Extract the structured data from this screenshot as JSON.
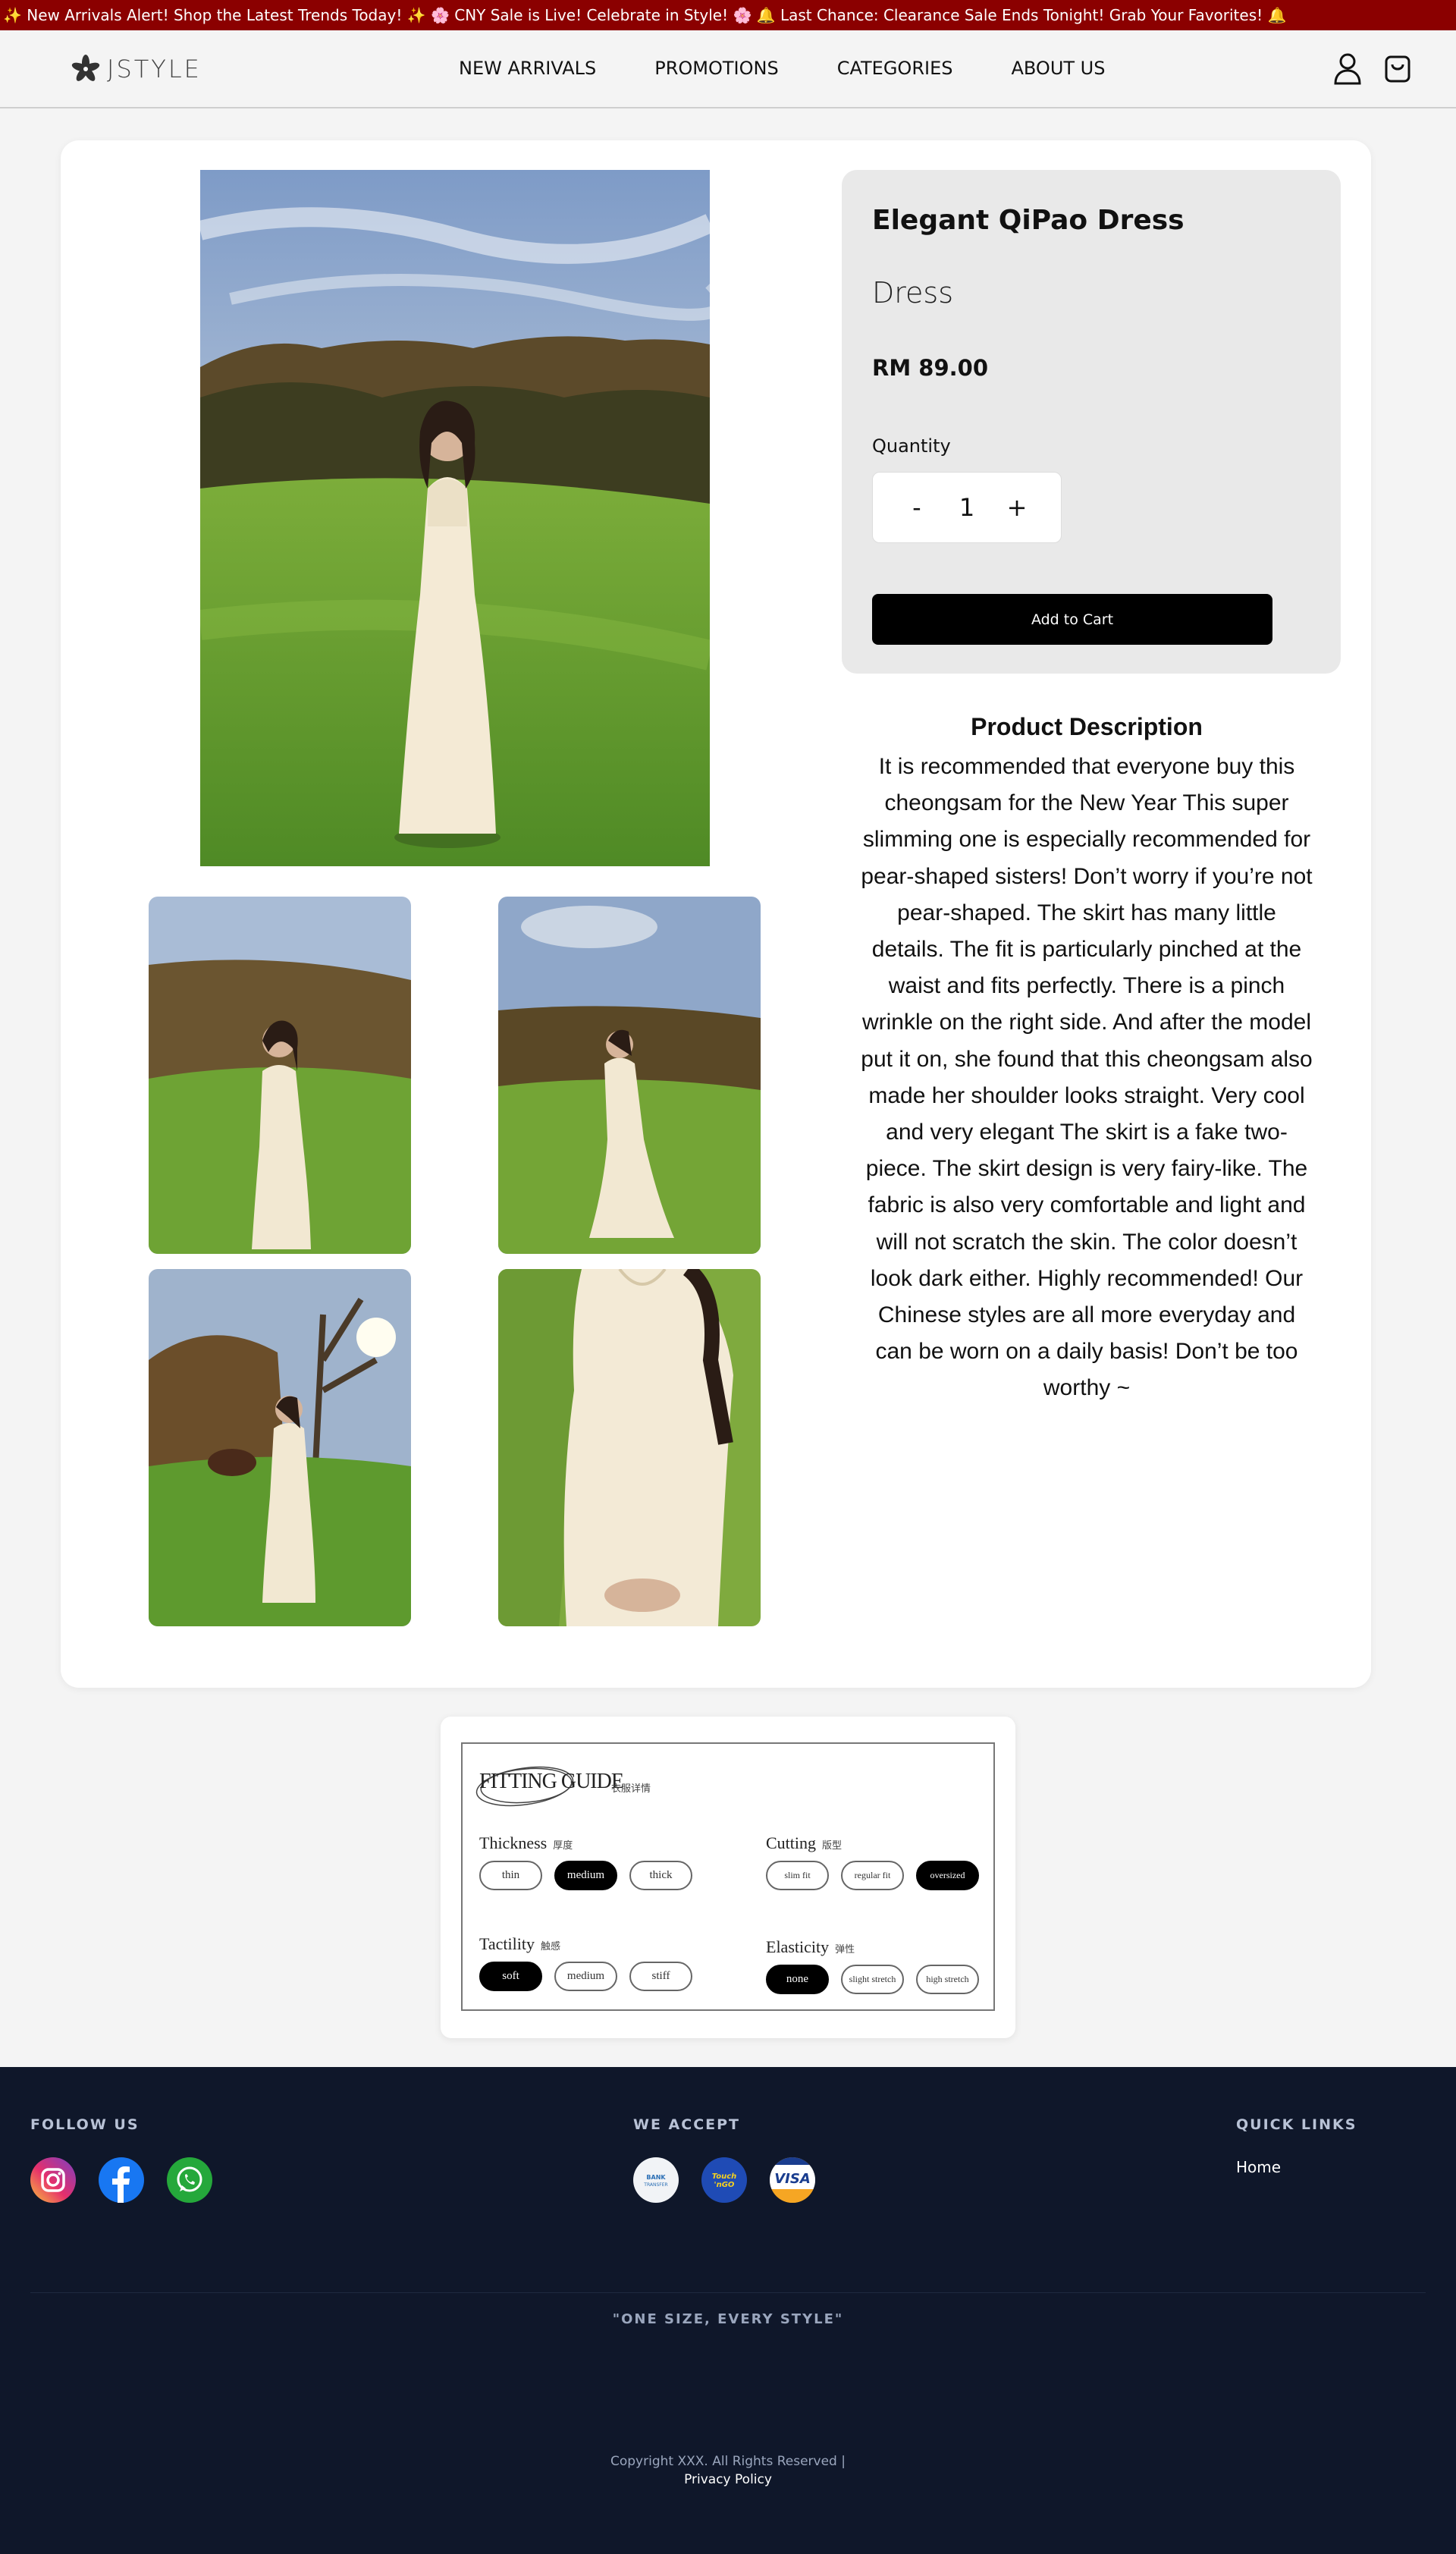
{
  "announcement": {
    "text": "✨ New Arrivals Alert! Shop the Latest Trends Today! ✨ 🌸 CNY Sale is Live! Celebrate in Style! 🌸 🔔 Last Chance: Clearance Sale Ends Tonight! Grab Your Favorites! 🔔",
    "background": "#8b0000"
  },
  "header": {
    "logo_text": "JSTYLE",
    "nav": [
      "NEW ARRIVALS",
      "PROMOTIONS",
      "CATEGORIES",
      "ABOUT US"
    ],
    "icons": [
      "user-icon",
      "cart-icon"
    ]
  },
  "product": {
    "name": "Elegant QiPao Dress",
    "category": "Dress",
    "price": "RM 89.00",
    "quantity_label": "Quantity",
    "quantity": "1",
    "minus": "-",
    "plus": "+",
    "add_to_cart": "Add to Cart",
    "images": [
      "main-photo",
      "thumb-photo-1",
      "thumb-photo-2",
      "thumb-photo-3",
      "thumb-photo-4"
    ]
  },
  "description": {
    "title": "Product Description",
    "text": "It is recommended that everyone buy this cheongsam for the New Year This super slimming one is especially recommended for pear-shaped sisters! Don’t worry if you’re not pear-shaped. The skirt has many little details. The fit is particularly pinched at the waist and fits perfectly. There is a pinch wrinkle on the right side. And after the model put it on, she found that this cheongsam also made her shoulder looks straight. Very cool and very elegant The skirt is a fake two-piece. The skirt design is very fairy-like. The fabric is also very comfortable and light and will not scratch the skin. The color doesn’t look dark either. Highly recommended! Our Chinese styles are all more everyday and can be worn on a daily basis! Don’t be too worthy ~"
  },
  "fitting_guide": {
    "title": "FITTING GUIDE",
    "title_sub": "衣服详情",
    "groups": [
      {
        "label": "Thickness",
        "sub": "厚度",
        "options": [
          "thin",
          "medium",
          "thick"
        ],
        "selected": "medium"
      },
      {
        "label": "Cutting",
        "sub": "版型",
        "options": [
          "slim fit",
          "regular fit",
          "oversized"
        ],
        "selected": "oversized"
      },
      {
        "label": "Tactility",
        "sub": "触感",
        "options": [
          "soft",
          "medium",
          "stiff"
        ],
        "selected": "soft"
      },
      {
        "label": "Elasticity",
        "sub": "弹性",
        "options": [
          "none",
          "slight stretch",
          "high stretch"
        ],
        "selected": "none"
      }
    ]
  },
  "footer": {
    "follow_us": "FOLLOW US",
    "social_icons": [
      "instagram-icon",
      "facebook-icon",
      "whatsapp-icon"
    ],
    "we_accept": "WE ACCEPT",
    "payment_icons": [
      "bank-transfer-icon",
      "touch-n-go-icon",
      "visa-icon"
    ],
    "quick_links": "QUICK LINKS",
    "links": [
      "Home"
    ],
    "slogan": "\"ONE SIZE, EVERY STYLE\"",
    "copyright": "Copyright XXX. All Rights Reserved |",
    "privacy": "Privacy Policy",
    "background": "#0f172a"
  }
}
